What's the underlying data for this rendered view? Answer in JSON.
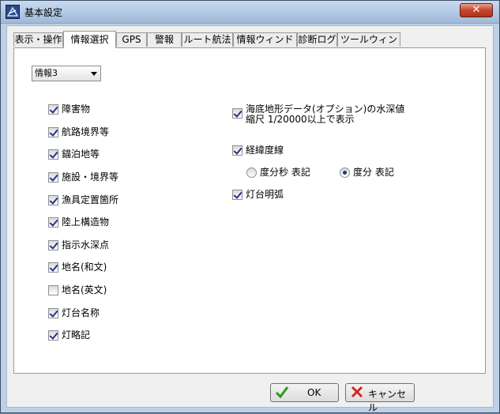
{
  "window": {
    "title": "基本設定",
    "close_glyph": "✕"
  },
  "tabs": [
    {
      "label": "表示・操作",
      "active": false
    },
    {
      "label": "情報選択",
      "active": true
    },
    {
      "label": "GPS",
      "active": false
    },
    {
      "label": "警報",
      "active": false
    },
    {
      "label": "ルート航法",
      "active": false
    },
    {
      "label": "情報ウィンドウ",
      "active": false
    },
    {
      "label": "診断ログ",
      "active": false
    },
    {
      "label": "ツールウィンドウ",
      "active": false
    }
  ],
  "dropdown": {
    "value": "情報3"
  },
  "left_checkboxes": [
    {
      "label": "障害物",
      "checked": true
    },
    {
      "label": "航路境界等",
      "checked": true
    },
    {
      "label": "錨泊地等",
      "checked": true
    },
    {
      "label": "施設・境界等",
      "checked": true
    },
    {
      "label": "漁具定置箇所",
      "checked": true
    },
    {
      "label": "陸上構造物",
      "checked": true
    },
    {
      "label": "指示水深点",
      "checked": true
    },
    {
      "label": "地名(和文)",
      "checked": true
    },
    {
      "label": "地名(英文)",
      "checked": false
    },
    {
      "label": "灯台名称",
      "checked": true
    },
    {
      "label": "灯略記",
      "checked": true
    }
  ],
  "right": {
    "depth": {
      "line1": "海底地形データ(オプション)の水深値",
      "line2": "縮尺 1/20000以上で表示",
      "checked": true
    },
    "latlon": {
      "label": "経緯度線",
      "checked": true
    },
    "radio_dms": {
      "label": "度分秒 表記",
      "selected": false
    },
    "radio_dm": {
      "label": "度分 表記",
      "selected": true
    },
    "lighthouse_arc": {
      "label": "灯台明弧",
      "checked": true
    }
  },
  "buttons": {
    "ok": "OK",
    "cancel": "キャンセル"
  }
}
